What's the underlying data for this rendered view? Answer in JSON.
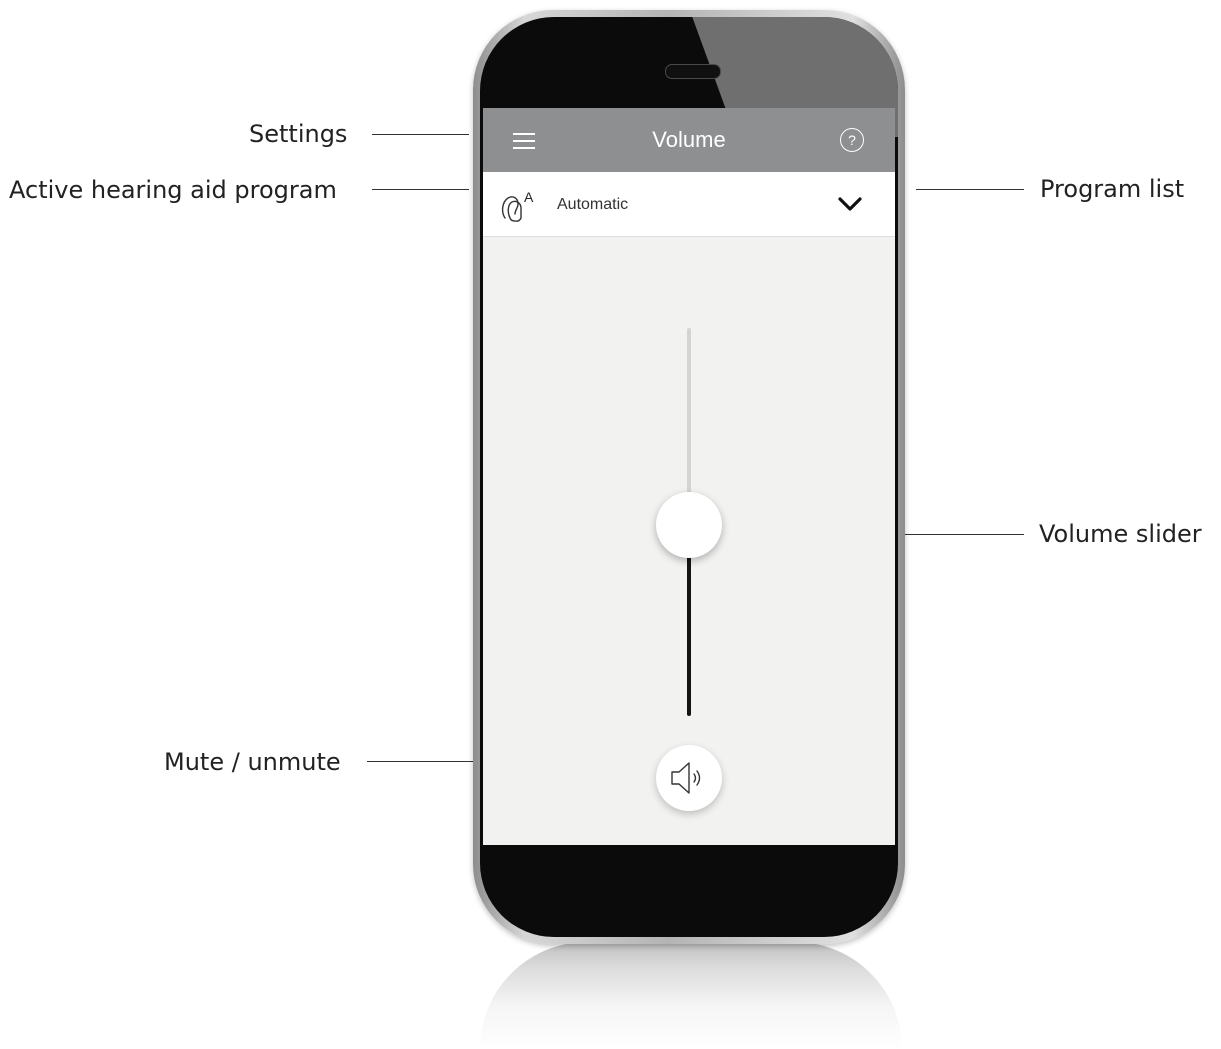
{
  "callouts": {
    "settings": "Settings",
    "active_program": "Active hearing aid program",
    "program_list": "Program list",
    "volume_slider": "Volume slider",
    "mute": "Mute / unmute"
  },
  "app": {
    "header_title": "Volume",
    "help_label": "?",
    "program": {
      "badge": "A",
      "name": "Automatic"
    },
    "volume": {
      "level": 0.5
    },
    "icons": {
      "menu": "hamburger-menu-icon",
      "help": "question-circle-icon",
      "program": "hearing-aid-icon",
      "dropdown": "chevron-down-icon",
      "mute": "speaker-icon"
    },
    "colors": {
      "header": "#8e8f91",
      "screen_bg": "#f2f2f0",
      "track_active": "#141414",
      "track_inactive": "#d4d4d4"
    }
  }
}
